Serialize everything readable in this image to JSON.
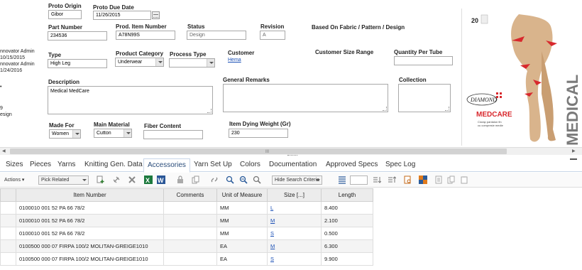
{
  "left_sidebar": {
    "lines": [
      "nnovator Admin",
      "10/15/2015",
      "nnovator Admin",
      "1/24/2016",
      "",
      "",
      "9",
      "esign"
    ]
  },
  "form": {
    "proto_origin": {
      "label": "Proto Origin",
      "value": "Gibor"
    },
    "proto_due_date": {
      "label": "Proto Due Date",
      "value": "11/26/2015"
    },
    "part_number": {
      "label": "Part Number",
      "value": "234536"
    },
    "prod_item_number": {
      "label": "Prod. Item Number",
      "value": "A78N99S"
    },
    "status": {
      "label": "Status",
      "value": "Design"
    },
    "revision": {
      "label": "Revision",
      "value": "A"
    },
    "based_on": {
      "label": "Based On Fabric / Pattern / Design"
    },
    "type": {
      "label": "Type",
      "value": "High Leg"
    },
    "product_category": {
      "label": "Product Category",
      "value": "Underwear"
    },
    "process_type": {
      "label": "Process Type",
      "value": ""
    },
    "customer": {
      "label": "Customer",
      "value": "Hema"
    },
    "customer_size_range": {
      "label": "Customer Size Range"
    },
    "quantity_per_tube": {
      "label": "Quantity Per Tube",
      "value": ""
    },
    "description": {
      "label": "Description",
      "value": "Medical MedCare"
    },
    "general_remarks": {
      "label": "General Remarks",
      "value": ""
    },
    "collection": {
      "label": "Collection",
      "value": ""
    },
    "made_for": {
      "label": "Made For",
      "value": "Women"
    },
    "main_material": {
      "label": "Main Material",
      "value": "Cutton"
    },
    "fiber_content": {
      "label": "Fiber Content",
      "value": ""
    },
    "item_dying_weight": {
      "label": "Item Dying Weight (Gr)",
      "value": "230"
    }
  },
  "product_image": {
    "brand": "DIAMOND",
    "sub_brand": "MEDCARE",
    "side_text": "MEDICAL",
    "size_badge": "20",
    "caption_line1": "Ciorap pantalon fin",
    "caption_line2": "cu compresie medie"
  },
  "scrollbar": {
    "grip": "III"
  },
  "tabs": [
    "Sizes",
    "Pieces",
    "Yarns",
    "Knitting Gen. Data",
    "Accessories",
    "Yarn Set Up",
    "Colors",
    "Documentation",
    "Approved Specs",
    "Spec Log"
  ],
  "active_tab": "Accessories",
  "toolbar": {
    "actions_label": "Actions",
    "pick_related": "Pick Related",
    "search_criteria": "Hide Search Criteria"
  },
  "grid": {
    "columns": [
      "Item Number",
      "Comments",
      "Unit of Measure",
      "Size [...]",
      "Length"
    ],
    "rows": [
      {
        "item": "0100010 001 52 PA 66 78/2",
        "comments": "",
        "uom": "MM",
        "size": "L",
        "length": "8.400"
      },
      {
        "item": "0100010 001 52 PA 66 78/2",
        "comments": "",
        "uom": "MM",
        "size": "M",
        "length": "2.100"
      },
      {
        "item": "0100010 001 52 PA 66 78/2",
        "comments": "",
        "uom": "MM",
        "size": "S",
        "length": "0.500"
      },
      {
        "item": "0100500 000 07 FIRPA 100/2 MOLITAN-GREIGE1010",
        "comments": "",
        "uom": "EA",
        "size": "M",
        "length": "6.300"
      },
      {
        "item": "0100500 000 07 FIRPA 100/2 MOLITAN-GREIGE1010",
        "comments": "",
        "uom": "EA",
        "size": "S",
        "length": "9.900"
      }
    ]
  }
}
